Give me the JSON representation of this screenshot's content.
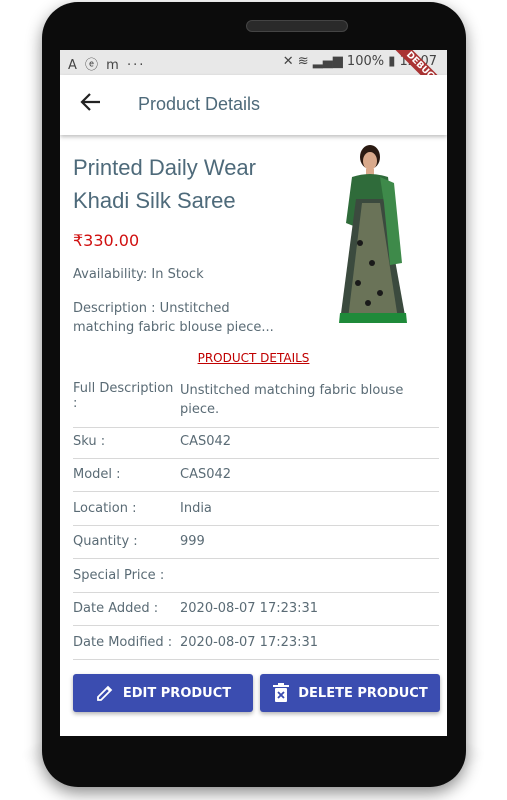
{
  "status_bar": {
    "left_icons": "A ⓔ m ···",
    "battery": "100%",
    "time": "12:07",
    "debug_banner": "DEBUG"
  },
  "app_bar": {
    "title": "Product Details",
    "back_icon": "arrow-left-icon"
  },
  "product": {
    "title": "Printed Daily Wear Khadi Silk Saree",
    "price": "₹330.00",
    "availability": "Availability: In Stock",
    "description": "Description : Unstitched matching fabric blouse piece..."
  },
  "section_link": "PRODUCT DETAILS",
  "full_description": {
    "label": "Full Description :",
    "value": "Unstitched matching fabric blouse piece."
  },
  "details": [
    {
      "label": "Sku :",
      "value": "CAS042"
    },
    {
      "label": "Model :",
      "value": "CAS042"
    },
    {
      "label": "Location :",
      "value": "India"
    },
    {
      "label": "Quantity :",
      "value": "999"
    },
    {
      "label": "Special Price :",
      "value": ""
    },
    {
      "label": "Date Added :",
      "value": "2020-08-07 17:23:31"
    },
    {
      "label": "Date Modified :",
      "value": "2020-08-07 17:23:31"
    }
  ],
  "actions": {
    "edit_label": "EDIT PRODUCT",
    "edit_icon": "pencil-icon",
    "delete_label": "DELETE PRODUCT",
    "delete_icon": "trash-icon"
  },
  "colors": {
    "primary_button": "#3b4db0",
    "price": "#d01010",
    "link": "#c00000"
  }
}
